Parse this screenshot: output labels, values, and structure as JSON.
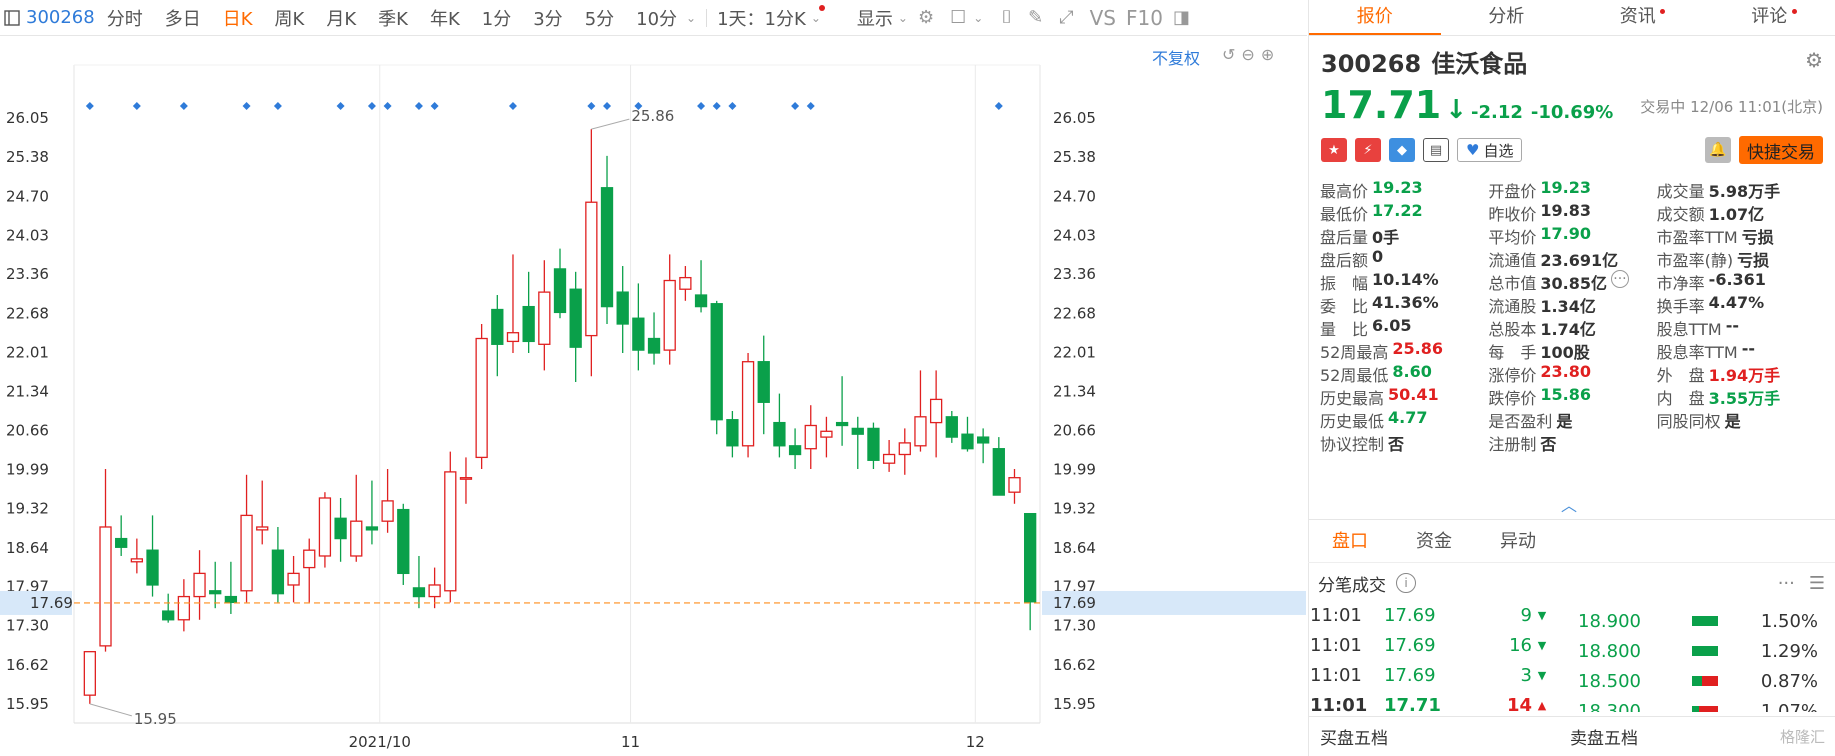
{
  "toolbar": {
    "stock_code": "300268",
    "tabs": [
      "分时",
      "多日",
      "日K",
      "周K",
      "月K",
      "季K",
      "年K",
      "1分",
      "3分",
      "5分",
      "10分"
    ],
    "active_tab": "日K",
    "multi_day": "1天：1分K",
    "display": "显示",
    "vs": "VS",
    "f10": "F10"
  },
  "chart": {
    "restore_label": "不复权",
    "y_ticks": [
      "26.05",
      "25.38",
      "24.70",
      "24.03",
      "23.36",
      "22.68",
      "22.01",
      "21.34",
      "20.66",
      "19.99",
      "19.32",
      "18.64",
      "17.97",
      "17.30",
      "16.62",
      "15.95"
    ],
    "current_price_label": "17.69",
    "x_labels": [
      {
        "label": "2021/10",
        "index": 19
      },
      {
        "label": "11",
        "index": 35
      },
      {
        "label": "12",
        "index": 57
      }
    ],
    "max_annotation": "25.86",
    "min_annotation": "15.95"
  },
  "chart_data": {
    "type": "candlestick",
    "ylim": [
      15.62,
      26.38
    ],
    "current_price": 17.69,
    "marker_indices": [
      0,
      3,
      6,
      10,
      12,
      16,
      18,
      19,
      21,
      22,
      27,
      32,
      33,
      35,
      39,
      40,
      41,
      45,
      46,
      58
    ],
    "candles": [
      {
        "o": 16.1,
        "h": 16.85,
        "l": 15.95,
        "c": 16.85
      },
      {
        "o": 16.95,
        "h": 20.0,
        "l": 16.85,
        "c": 19.0
      },
      {
        "o": 18.8,
        "h": 19.2,
        "l": 18.5,
        "c": 18.65
      },
      {
        "o": 18.4,
        "h": 18.8,
        "l": 18.2,
        "c": 18.45
      },
      {
        "o": 18.6,
        "h": 19.2,
        "l": 17.8,
        "c": 18.0
      },
      {
        "o": 17.55,
        "h": 17.85,
        "l": 17.35,
        "c": 17.4
      },
      {
        "o": 17.4,
        "h": 18.1,
        "l": 17.2,
        "c": 17.8
      },
      {
        "o": 17.8,
        "h": 18.6,
        "l": 17.4,
        "c": 18.2
      },
      {
        "o": 17.9,
        "h": 18.4,
        "l": 17.6,
        "c": 17.85
      },
      {
        "o": 17.8,
        "h": 18.4,
        "l": 17.5,
        "c": 17.7
      },
      {
        "o": 17.9,
        "h": 19.9,
        "l": 17.7,
        "c": 19.2
      },
      {
        "o": 18.95,
        "h": 19.8,
        "l": 18.7,
        "c": 19.0
      },
      {
        "o": 18.6,
        "h": 19.0,
        "l": 17.7,
        "c": 17.85
      },
      {
        "o": 18.0,
        "h": 18.5,
        "l": 17.7,
        "c": 18.2
      },
      {
        "o": 18.3,
        "h": 18.8,
        "l": 17.7,
        "c": 18.6
      },
      {
        "o": 18.5,
        "h": 19.6,
        "l": 18.3,
        "c": 19.5
      },
      {
        "o": 19.15,
        "h": 19.5,
        "l": 18.4,
        "c": 18.8
      },
      {
        "o": 18.5,
        "h": 19.9,
        "l": 18.4,
        "c": 19.1
      },
      {
        "o": 19.0,
        "h": 19.8,
        "l": 18.7,
        "c": 18.95
      },
      {
        "o": 19.1,
        "h": 20.0,
        "l": 18.9,
        "c": 19.45
      },
      {
        "o": 19.3,
        "h": 19.4,
        "l": 18.0,
        "c": 18.2
      },
      {
        "o": 17.95,
        "h": 18.5,
        "l": 17.6,
        "c": 17.8
      },
      {
        "o": 17.8,
        "h": 18.3,
        "l": 17.6,
        "c": 18.0
      },
      {
        "o": 17.9,
        "h": 20.3,
        "l": 17.7,
        "c": 19.95
      },
      {
        "o": 19.85,
        "h": 20.2,
        "l": 19.4,
        "c": 19.85
      },
      {
        "o": 20.2,
        "h": 22.5,
        "l": 20.0,
        "c": 22.25
      },
      {
        "o": 22.75,
        "h": 23.0,
        "l": 21.6,
        "c": 22.15
      },
      {
        "o": 22.2,
        "h": 23.7,
        "l": 22.0,
        "c": 22.35
      },
      {
        "o": 22.8,
        "h": 23.4,
        "l": 22.0,
        "c": 22.2
      },
      {
        "o": 22.15,
        "h": 23.6,
        "l": 21.7,
        "c": 23.05
      },
      {
        "o": 23.45,
        "h": 23.8,
        "l": 22.6,
        "c": 22.7
      },
      {
        "o": 23.1,
        "h": 23.4,
        "l": 21.5,
        "c": 22.1
      },
      {
        "o": 22.3,
        "h": 25.86,
        "l": 21.6,
        "c": 24.6
      },
      {
        "o": 24.85,
        "h": 25.4,
        "l": 22.5,
        "c": 22.8
      },
      {
        "o": 23.05,
        "h": 23.5,
        "l": 22.0,
        "c": 22.5
      },
      {
        "o": 22.6,
        "h": 23.2,
        "l": 21.7,
        "c": 22.05
      },
      {
        "o": 22.25,
        "h": 22.7,
        "l": 21.8,
        "c": 22.0
      },
      {
        "o": 22.05,
        "h": 23.7,
        "l": 21.8,
        "c": 23.25
      },
      {
        "o": 23.1,
        "h": 23.5,
        "l": 22.9,
        "c": 23.3
      },
      {
        "o": 23.0,
        "h": 23.6,
        "l": 22.7,
        "c": 22.8
      },
      {
        "o": 22.85,
        "h": 22.9,
        "l": 20.6,
        "c": 20.85
      },
      {
        "o": 20.85,
        "h": 21.0,
        "l": 20.2,
        "c": 20.4
      },
      {
        "o": 20.4,
        "h": 22.0,
        "l": 20.2,
        "c": 21.85
      },
      {
        "o": 21.85,
        "h": 22.3,
        "l": 20.6,
        "c": 21.15
      },
      {
        "o": 20.8,
        "h": 21.3,
        "l": 20.2,
        "c": 20.4
      },
      {
        "o": 20.4,
        "h": 20.7,
        "l": 20.0,
        "c": 20.25
      },
      {
        "o": 20.35,
        "h": 21.1,
        "l": 20.0,
        "c": 20.75
      },
      {
        "o": 20.55,
        "h": 20.9,
        "l": 20.2,
        "c": 20.65
      },
      {
        "o": 20.8,
        "h": 21.6,
        "l": 20.4,
        "c": 20.75
      },
      {
        "o": 20.7,
        "h": 20.9,
        "l": 20.0,
        "c": 20.6
      },
      {
        "o": 20.7,
        "h": 20.8,
        "l": 20.0,
        "c": 20.15
      },
      {
        "o": 20.1,
        "h": 20.5,
        "l": 19.95,
        "c": 20.25
      },
      {
        "o": 20.25,
        "h": 20.7,
        "l": 19.9,
        "c": 20.45
      },
      {
        "o": 20.4,
        "h": 21.7,
        "l": 20.3,
        "c": 20.9
      },
      {
        "o": 20.8,
        "h": 21.7,
        "l": 20.2,
        "c": 21.2
      },
      {
        "o": 20.9,
        "h": 21.0,
        "l": 20.45,
        "c": 20.55
      },
      {
        "o": 20.6,
        "h": 20.9,
        "l": 20.3,
        "c": 20.35
      },
      {
        "o": 20.55,
        "h": 20.7,
        "l": 20.1,
        "c": 20.45
      },
      {
        "o": 20.35,
        "h": 20.55,
        "l": 19.55,
        "c": 19.55
      },
      {
        "o": 19.6,
        "h": 20.0,
        "l": 19.4,
        "c": 19.85
      },
      {
        "o": 19.23,
        "h": 19.23,
        "l": 17.22,
        "c": 17.71
      }
    ]
  },
  "panel": {
    "tabs": [
      "报价",
      "分析",
      "资讯",
      "评论"
    ],
    "active_tab": "报价",
    "code": "300268",
    "name": "佳沃食品",
    "price": "17.71",
    "arrow": "↓",
    "change": "-2.12",
    "change_pct": "-10.69%",
    "status_time": "交易中 12/06 11:01(北京)",
    "fav_label": "自选",
    "quick_trade": "快捷交易",
    "more_dots": "···",
    "stats": [
      [
        [
          "最高价",
          "19.23",
          "green"
        ],
        [
          "开盘价",
          "19.23",
          "green"
        ],
        [
          "成交量",
          "5.98万手",
          "dark"
        ]
      ],
      [
        [
          "最低价",
          "17.22",
          "green"
        ],
        [
          "昨收价",
          "19.83",
          "dark"
        ],
        [
          "成交额",
          "1.07亿",
          "dark"
        ]
      ],
      [
        [
          "盘后量",
          "0手",
          "dark"
        ],
        [
          "平均价",
          "17.90",
          "green"
        ],
        [
          "市盈率TTM",
          "亏损",
          "dark"
        ]
      ],
      [
        [
          "盘后额",
          "0",
          "dark"
        ],
        [
          "流通值",
          "23.691亿",
          "dark"
        ],
        [
          "市盈率(静)",
          "亏损",
          "dark"
        ]
      ],
      [
        [
          "振　幅",
          "10.14%",
          "dark"
        ],
        [
          "总市值",
          "30.85亿",
          "dark"
        ],
        [
          "市净率",
          "-6.361",
          "dark"
        ]
      ],
      [
        [
          "委　比",
          "41.36%",
          "dark"
        ],
        [
          "流通股",
          "1.34亿",
          "dark"
        ],
        [
          "换手率",
          "4.47%",
          "dark"
        ]
      ],
      [
        [
          "量　比",
          "6.05",
          "dark"
        ],
        [
          "总股本",
          "1.74亿",
          "dark"
        ],
        [
          "股息TTM",
          "--",
          "dark"
        ]
      ],
      [
        [
          "52周最高",
          "25.86",
          "red"
        ],
        [
          "每　手",
          "100股",
          "dark"
        ],
        [
          "股息率TTM",
          "--",
          "dark"
        ]
      ],
      [
        [
          "52周最低",
          "8.60",
          "green"
        ],
        [
          "涨停价",
          "23.80",
          "red"
        ],
        [
          "外　盘",
          "1.94万手",
          "red"
        ]
      ],
      [
        [
          "历史最高",
          "50.41",
          "red"
        ],
        [
          "跌停价",
          "15.86",
          "green"
        ],
        [
          "内　盘",
          "3.55万手",
          "green"
        ]
      ],
      [
        [
          "历史最低",
          "4.77",
          "green"
        ],
        [
          "是否盈利",
          "是",
          "dark"
        ],
        [
          "同股同权",
          "是",
          "dark"
        ]
      ],
      [
        [
          "协议控制",
          "否",
          "dark"
        ],
        [
          "注册制",
          "否",
          "dark"
        ],
        [
          "",
          "",
          "dark"
        ]
      ]
    ],
    "sub_tabs": [
      "盘口",
      "资金",
      "异动"
    ],
    "active_sub_tab": "盘口",
    "ticks_title": "分笔成交",
    "ticks": [
      {
        "time": "11:01",
        "price": "17.69",
        "vol": "9",
        "dir": "down"
      },
      {
        "time": "11:01",
        "price": "17.69",
        "vol": "16",
        "dir": "down"
      },
      {
        "time": "11:01",
        "price": "17.69",
        "vol": "3",
        "dir": "down"
      },
      {
        "time": "11:01",
        "price": "17.71",
        "vol": "14",
        "dir": "up"
      }
    ],
    "levels": [
      {
        "price": "18.900",
        "pct": "1.50%",
        "green": 1.0
      },
      {
        "price": "18.800",
        "pct": "1.29%",
        "green": 1.0
      },
      {
        "price": "18.500",
        "pct": "0.87%",
        "green": 0.4
      },
      {
        "price": "18.300",
        "pct": "1.07%",
        "green": 0.3
      }
    ],
    "buy5": "买盘五档",
    "sell5": "卖盘五档",
    "watermark": "格隆汇"
  },
  "colors": {
    "up": "#e02020",
    "down": "#0aa04a",
    "accent": "#ff6a00",
    "link": "#2f7bd9",
    "dash": "#ff8c1a"
  }
}
